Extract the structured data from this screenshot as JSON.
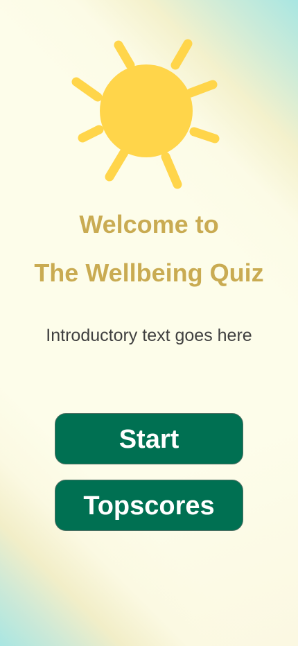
{
  "colors": {
    "sun": "#ffd54a",
    "title": "#c9ab52",
    "button_bg": "#007052",
    "button_text": "#ffffff",
    "intro_text": "#3f3f3f"
  },
  "hero": {
    "icon": "sun-icon"
  },
  "title": {
    "line1": "Welcome to",
    "line2": "The Wellbeing Quiz"
  },
  "intro": {
    "text": "Introductory text goes here"
  },
  "buttons": {
    "start_label": "Start",
    "topscores_label": "Topscores"
  }
}
